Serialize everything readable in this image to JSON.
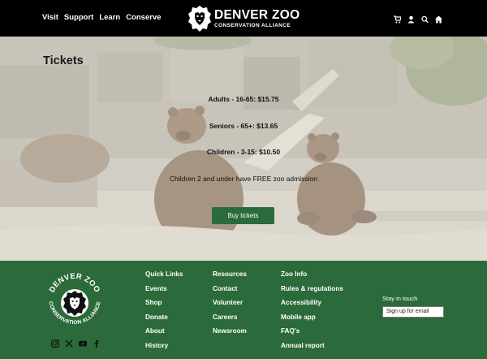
{
  "header": {
    "nav": [
      "Visit",
      "Support",
      "Learn",
      "Conserve"
    ],
    "logo_title": "DENVER ZOO",
    "logo_subtitle": "CONSERVATION ALLIANCE",
    "icons": [
      "cart-icon",
      "user-icon",
      "search-icon",
      "home-icon"
    ]
  },
  "hero": {
    "title": "Tickets",
    "prices": [
      "Adults - 16-65: $15.75",
      "Seniors - 65+: $13.65",
      "Children - 3-15: $10.50"
    ],
    "note": "Children 2 and under have FREE zoo admission",
    "button": "Buy tickets"
  },
  "footer": {
    "badge_top": "DENVER ZOO",
    "badge_bottom": "CONSERVATION ALLIANCE",
    "social": [
      "instagram-icon",
      "x-icon",
      "youtube-icon",
      "facebook-icon"
    ],
    "col1": [
      "Quick Links",
      "Events",
      "Shop",
      "Donate",
      "About",
      "History"
    ],
    "col2": [
      "Resources",
      "Contact",
      "Volunteer",
      "Careers",
      "Newsroom"
    ],
    "col3": [
      "Zoo Info",
      "Rules & regulations",
      "Accessibility",
      "Mobile app",
      "FAQ's",
      "Annual report"
    ],
    "stay_label": "Stay in touch",
    "signup": "Sign up for email"
  },
  "colors": {
    "header_bg": "#000000",
    "footer_bg": "#2b6a3a",
    "button_bg": "#2b6a3a"
  }
}
